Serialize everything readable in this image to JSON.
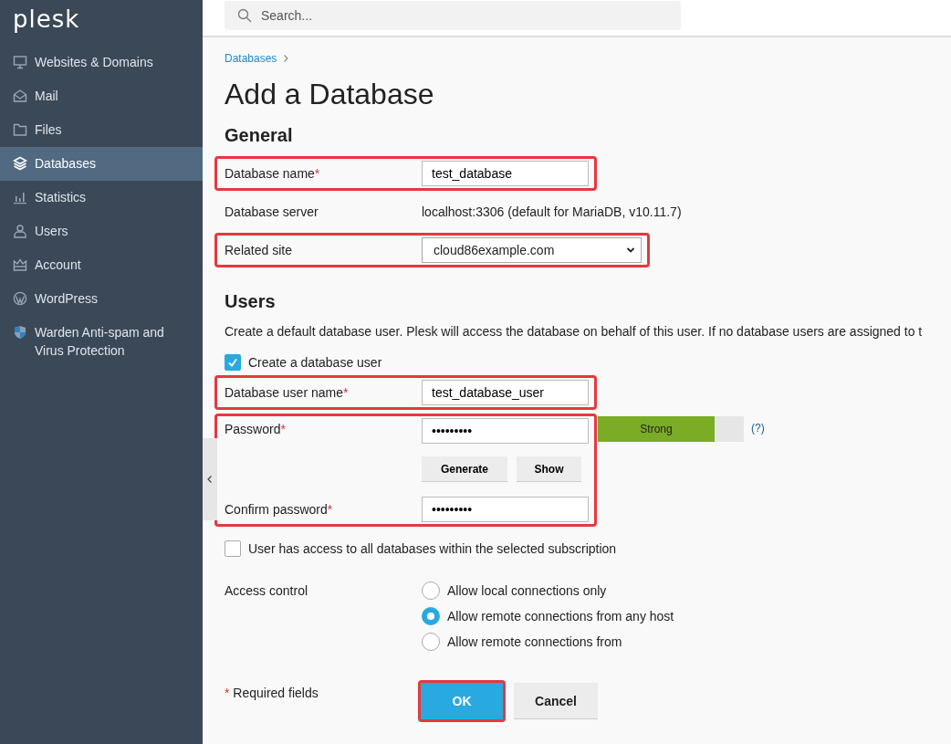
{
  "sidebar": {
    "logo": "plesk",
    "items": [
      {
        "label": "Websites & Domains",
        "kind": "monitor",
        "selected": false
      },
      {
        "label": "Mail",
        "kind": "mail",
        "selected": false
      },
      {
        "label": "Files",
        "kind": "folder",
        "selected": false
      },
      {
        "label": "Databases",
        "kind": "layers",
        "selected": true
      },
      {
        "label": "Statistics",
        "kind": "chart",
        "selected": false
      },
      {
        "label": "Users",
        "kind": "user",
        "selected": false
      },
      {
        "label": "Account",
        "kind": "crown",
        "selected": false
      },
      {
        "label": "WordPress",
        "kind": "wordpress",
        "selected": false
      },
      {
        "label": "Warden Anti-spam and Virus Protection",
        "kind": "shield",
        "selected": false
      }
    ]
  },
  "search": {
    "placeholder": "Search..."
  },
  "breadcrumb": [
    "Databases"
  ],
  "title": "Add a Database",
  "general": {
    "heading": "General",
    "fields": [
      {
        "kind": "input",
        "label": "Database name",
        "required_mark": "*",
        "value": "test_database",
        "highlighted": true
      },
      {
        "kind": "text",
        "label": "Database server",
        "value": "localhost:3306 (default for MariaDB, v10.11.7)",
        "highlighted": false
      },
      {
        "kind": "select",
        "label": "Related site",
        "value": "cloud86example.com",
        "highlighted": true
      }
    ]
  },
  "users": {
    "heading": "Users",
    "description": "Create a default database user. Plesk will access the database on behalf of this user. If no database users are assigned to t",
    "create_user": {
      "label": "Create a database user",
      "checked": true
    },
    "user_name": {
      "label": "Database user name",
      "required_mark": "*",
      "value": "test_database_user",
      "highlighted": true
    },
    "password_group": {
      "highlighted": true,
      "password": {
        "label": "Password",
        "required_mark": "*",
        "value": "•••••••••"
      },
      "strength": {
        "label": "Strong",
        "level": 0.8
      },
      "help": "(?)",
      "buttons": [
        "Generate",
        "Show"
      ],
      "confirm": {
        "label": "Confirm password",
        "required_mark": "*",
        "value": "•••••••••"
      }
    },
    "all_databases": {
      "label": "User has access to all databases within the selected subscription",
      "checked": false
    },
    "access_control": {
      "label": "Access control",
      "options": [
        {
          "label": "Allow local connections only",
          "selected": false
        },
        {
          "label": "Allow remote connections from any host",
          "selected": true
        },
        {
          "label": "Allow remote connections from",
          "selected": false
        }
      ]
    }
  },
  "footer": {
    "required_mark": "*",
    "required_note": "Required fields",
    "buttons": [
      {
        "label": "OK",
        "kind": "primary",
        "highlighted": true
      },
      {
        "label": "Cancel",
        "kind": "secondary",
        "highlighted": false
      }
    ]
  }
}
